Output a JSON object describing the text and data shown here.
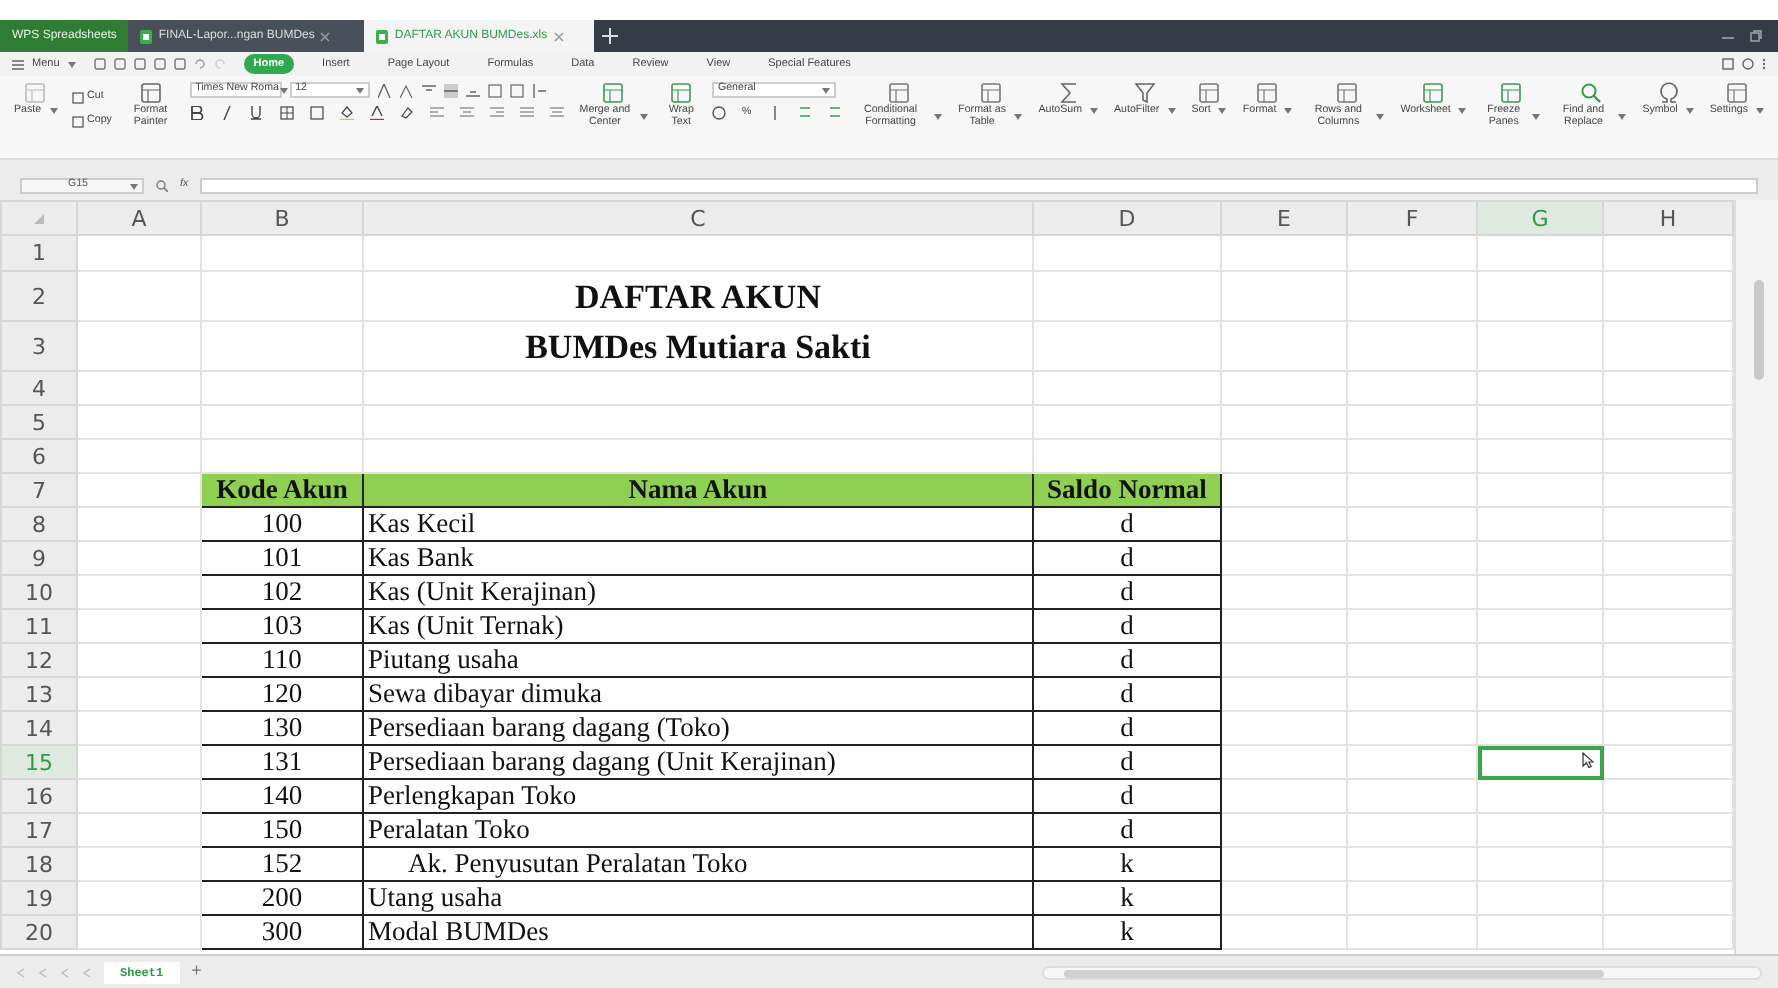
{
  "tabs": [
    {
      "label": "WPS Spreadsheets",
      "kind": "app",
      "selected": false
    },
    {
      "label": "FINAL-Lapor...ngan BUMDes",
      "kind": "doc",
      "selected": false
    },
    {
      "label": "DAFTAR AKUN BUMDes.xls",
      "kind": "doc",
      "selected": true
    }
  ],
  "menu_button": "Menu",
  "ribbon_tabs": [
    {
      "label": "Home",
      "selected": true
    },
    {
      "label": "Insert",
      "selected": false
    },
    {
      "label": "Page Layout",
      "selected": false
    },
    {
      "label": "Formulas",
      "selected": false
    },
    {
      "label": "Data",
      "selected": false
    },
    {
      "label": "Review",
      "selected": false
    },
    {
      "label": "View",
      "selected": false
    },
    {
      "label": "Special Features",
      "selected": false
    }
  ],
  "clipboard": [
    {
      "label": "Paste",
      "kind": "big",
      "dropdown": true,
      "disabled": true
    },
    {
      "label": "Cut",
      "kind": "small",
      "dropdown": false,
      "disabled": false
    },
    {
      "label": "Copy",
      "kind": "small",
      "dropdown": false,
      "disabled": false
    },
    {
      "label": "Format Painter",
      "kind": "big",
      "dropdown": false,
      "disabled": false
    }
  ],
  "font": {
    "name": "Times New Roma",
    "size": "12"
  },
  "align_buttons": [
    {
      "label": "Merge and Center",
      "dropdown": true
    },
    {
      "label": "Wrap Text",
      "dropdown": false
    }
  ],
  "number_format": {
    "value": "General",
    "percent": "%"
  },
  "tools": [
    {
      "label": "Conditional Formatting",
      "dropdown": true
    },
    {
      "label": "Format as Table",
      "dropdown": true
    },
    {
      "label": "AutoSum",
      "dropdown": true
    },
    {
      "label": "AutoFilter",
      "dropdown": true
    },
    {
      "label": "Sort",
      "dropdown": true
    },
    {
      "label": "Format",
      "dropdown": true
    },
    {
      "label": "Rows and Columns",
      "dropdown": true
    },
    {
      "label": "Worksheet",
      "dropdown": true
    },
    {
      "label": "Freeze Panes",
      "dropdown": true
    },
    {
      "label": "Find and Replace",
      "dropdown": true
    },
    {
      "label": "Symbol",
      "dropdown": true
    },
    {
      "label": "Settings",
      "dropdown": true
    }
  ],
  "name_box": "G15",
  "formula_label": "fx",
  "columns": [
    {
      "letter": "A",
      "selected": false
    },
    {
      "letter": "B",
      "selected": false
    },
    {
      "letter": "C",
      "selected": false
    },
    {
      "letter": "D",
      "selected": false
    },
    {
      "letter": "E",
      "selected": false
    },
    {
      "letter": "F",
      "selected": false
    },
    {
      "letter": "G",
      "selected": true
    },
    {
      "letter": "H",
      "selected": false
    }
  ],
  "rows": [
    {
      "number": "1",
      "kind": "blank",
      "selected": false
    },
    {
      "number": "2",
      "kind": "title",
      "selected": false,
      "cells": {
        "C": "DAFTAR AKUN"
      }
    },
    {
      "number": "3",
      "kind": "title",
      "selected": false,
      "cells": {
        "C": "BUMDes Mutiara Sakti"
      }
    },
    {
      "number": "4",
      "kind": "blank",
      "selected": false
    },
    {
      "number": "5",
      "kind": "blank",
      "selected": false
    },
    {
      "number": "6",
      "kind": "blank",
      "selected": false
    },
    {
      "number": "7",
      "kind": "header",
      "selected": false,
      "cells": {
        "B": "Kode Akun",
        "C": "Nama Akun",
        "D": "Saldo Normal"
      }
    },
    {
      "number": "8",
      "kind": "data",
      "selected": false,
      "cells": {
        "B": "100",
        "C": "Kas Kecil",
        "D": "d"
      }
    },
    {
      "number": "9",
      "kind": "data",
      "selected": false,
      "cells": {
        "B": "101",
        "C": "Kas Bank",
        "D": "d"
      }
    },
    {
      "number": "10",
      "kind": "data",
      "selected": false,
      "cells": {
        "B": "102",
        "C": "Kas (Unit Kerajinan)",
        "D": "d"
      }
    },
    {
      "number": "11",
      "kind": "data",
      "selected": false,
      "cells": {
        "B": "103",
        "C": "Kas (Unit Ternak)",
        "D": "d"
      }
    },
    {
      "number": "12",
      "kind": "data",
      "selected": false,
      "cells": {
        "B": "110",
        "C": "Piutang usaha",
        "D": "d"
      }
    },
    {
      "number": "13",
      "kind": "data",
      "selected": false,
      "cells": {
        "B": "120",
        "C": "Sewa dibayar dimuka",
        "D": "d"
      }
    },
    {
      "number": "14",
      "kind": "data",
      "selected": false,
      "cells": {
        "B": "130",
        "C": "Persediaan barang dagang (Toko)",
        "D": "d"
      }
    },
    {
      "number": "15",
      "kind": "data",
      "selected": true,
      "cells": {
        "B": "131",
        "C": "Persediaan barang dagang (Unit Kerajinan)",
        "D": "d"
      }
    },
    {
      "number": "16",
      "kind": "data",
      "selected": false,
      "cells": {
        "B": "140",
        "C": "Perlengkapan Toko",
        "D": "d"
      }
    },
    {
      "number": "17",
      "kind": "data",
      "selected": false,
      "cells": {
        "B": "150",
        "C": "Peralatan Toko",
        "D": "d"
      }
    },
    {
      "number": "18",
      "kind": "data",
      "selected": false,
      "indent": true,
      "cells": {
        "B": "152",
        "C": "Ak. Penyusutan Peralatan Toko",
        "D": "k"
      }
    },
    {
      "number": "19",
      "kind": "data",
      "selected": false,
      "cells": {
        "B": "200",
        "C": "Utang usaha",
        "D": "k"
      }
    },
    {
      "number": "20",
      "kind": "data",
      "selected": false,
      "cells": {
        "B": "300",
        "C": "Modal BUMDes",
        "D": "k"
      }
    }
  ],
  "sheets": [
    {
      "label": "Sheet1",
      "selected": true
    }
  ],
  "add_sheet": "+"
}
